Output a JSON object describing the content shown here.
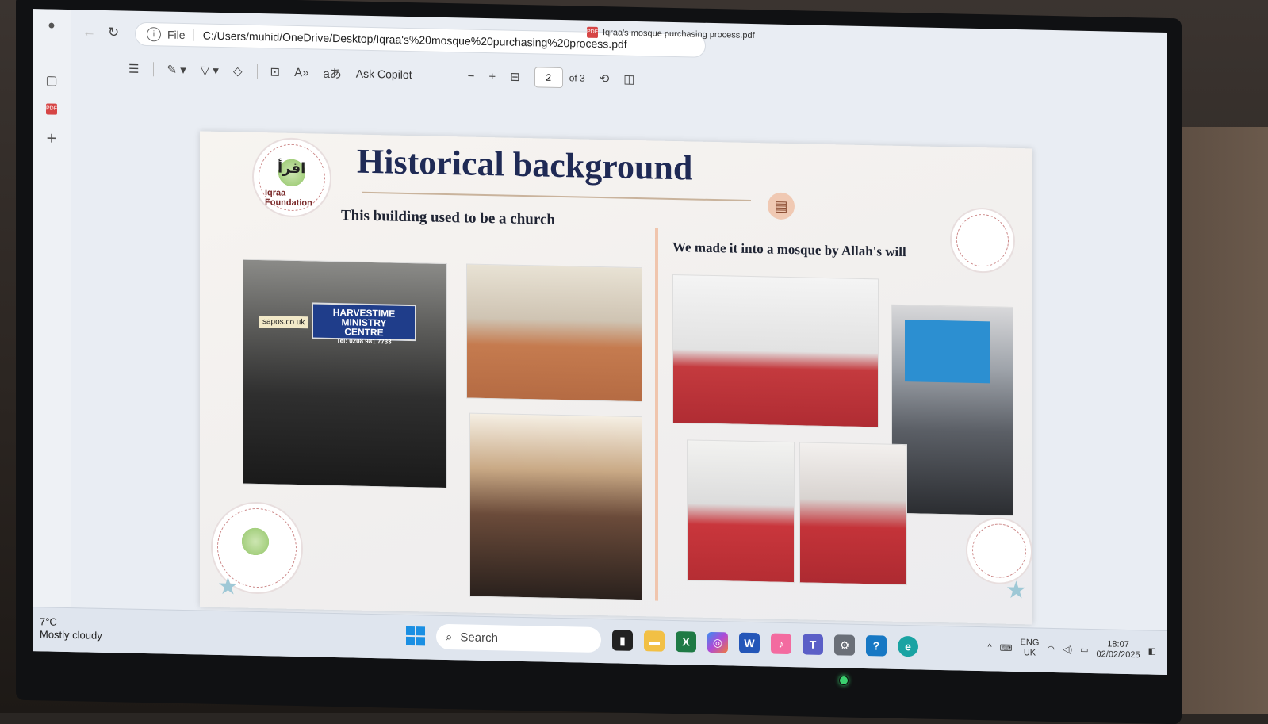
{
  "browser": {
    "tab_title": "Iqraa's mosque purchasing process.pdf",
    "url_scheme": "File",
    "url": "C:/Users/muhid/OneDrive/Desktop/Iqraa's%20mosque%20purchasing%20process.pdf"
  },
  "pdf_toolbar": {
    "ask_copilot": "Ask Copilot",
    "zoom_out": "−",
    "zoom_in": "+",
    "page_current": "2",
    "page_total": "of 3"
  },
  "document": {
    "title": "Historical background",
    "subtitle_left": "This building used to be a church",
    "subtitle_right": "We made it into a mosque by Allah's will",
    "sign_line1": "HARVESTIME",
    "sign_line2": "MINISTRY",
    "sign_line3": "CENTRE",
    "sign_phone": "Tel: 0208 981 7733",
    "shop_sticker": "sapos.co.uk",
    "logo_arabic": "اقرأ",
    "logo_text": "Iqraa Foundation"
  },
  "taskbar": {
    "temperature": "7°C",
    "weather": "Mostly cloudy",
    "search_label": "Search",
    "lang_top": "ENG",
    "lang_bottom": "UK",
    "time": "18:07",
    "date": "02/02/2025"
  },
  "colors": {
    "title": "#1f2a55",
    "divider": "#f0c5ad",
    "windows_blue": "#1a8fe3"
  }
}
